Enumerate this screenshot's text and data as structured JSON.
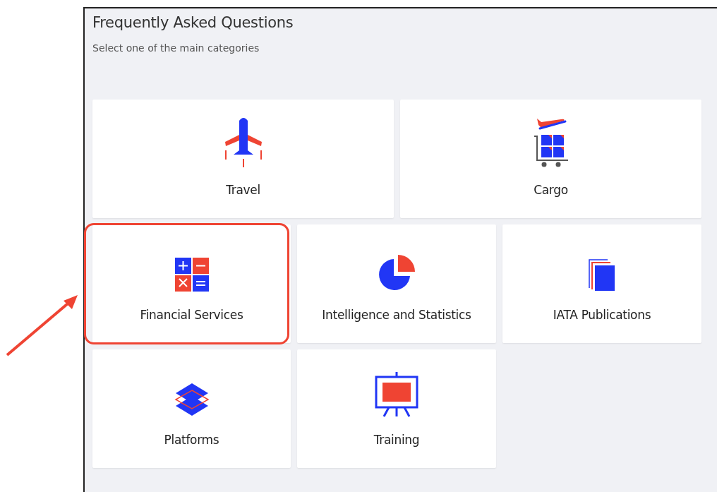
{
  "header": {
    "title": "Frequently Asked Questions",
    "subtitle": "Select one of the main categories"
  },
  "rows": [
    [
      {
        "label": "Travel",
        "kind": "plane",
        "highlighted": false
      },
      {
        "label": "Cargo",
        "kind": "cargo",
        "highlighted": false
      }
    ],
    [
      {
        "label": "Financial Services",
        "kind": "calculator",
        "highlighted": true
      },
      {
        "label": "Intelligence and Statistics",
        "kind": "pie",
        "highlighted": false
      },
      {
        "label": "IATA Publications",
        "kind": "pages",
        "highlighted": false
      }
    ],
    [
      {
        "label": "Platforms",
        "kind": "layers",
        "highlighted": false
      },
      {
        "label": "Training",
        "kind": "easel",
        "highlighted": false
      }
    ]
  ]
}
